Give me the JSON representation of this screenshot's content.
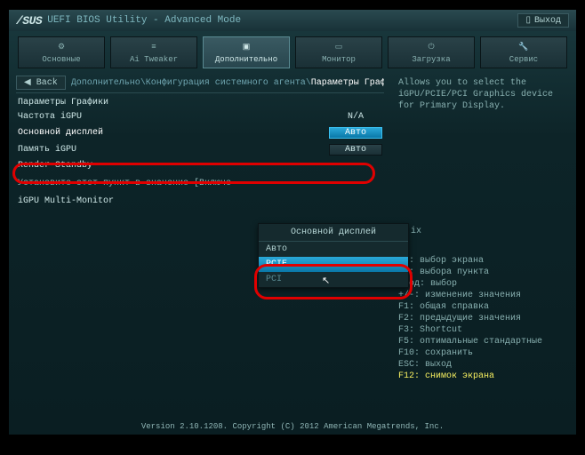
{
  "header": {
    "logo": "/SUS",
    "title": "UEFI BIOS Utility - Advanced Mode",
    "exit": "Выход"
  },
  "tabs": [
    {
      "label": "Основные"
    },
    {
      "label": "Ai Tweaker"
    },
    {
      "label": "Дополнительно"
    },
    {
      "label": "Монитор"
    },
    {
      "label": "Загрузка"
    },
    {
      "label": "Сервис"
    }
  ],
  "back": "Back",
  "breadcrumb": {
    "p1": "Дополнительно\\",
    "p2": "Конфигурация системного агента\\",
    "p3": "Параметры Графики"
  },
  "section_title": "Параметры Графики",
  "settings": {
    "igpu_freq": {
      "label": "Частота iGPU",
      "value": "N/A"
    },
    "primary_display": {
      "label": "Основной дисплей",
      "value": "Авто"
    },
    "igpu_mem": {
      "label": "Память iGPU",
      "value": "Авто"
    },
    "render_standby": {
      "label": "Render Standby",
      "value": ""
    },
    "note": "Установите этот пункт в значение [Включе",
    "multi_monitor": {
      "label": "iGPU Multi-Monitor",
      "value": ""
    }
  },
  "dropdown": {
    "title": "Основной дисплей",
    "options": [
      "Авто",
      "PCIE",
      "PCI"
    ],
    "suffix_hint": "ix"
  },
  "help": {
    "description": "Allows you to select the iGPU/PCIE/PCI Graphics device for Primary Display.",
    "keys": [
      "++: выбор экрана",
      "↑↓: выбора пункта",
      "Ввод: выбор",
      "+/-: изменение значения",
      "F1: общая справка",
      "F2: предыдущие значения",
      "F3: Shortcut",
      "F5: оптимальные стандартные",
      "F10: сохранить",
      "ESC: выход"
    ],
    "f12": "F12: снимок экрана"
  },
  "footer": "Version 2.10.1208. Copyright (C) 2012 American Megatrends, Inc."
}
